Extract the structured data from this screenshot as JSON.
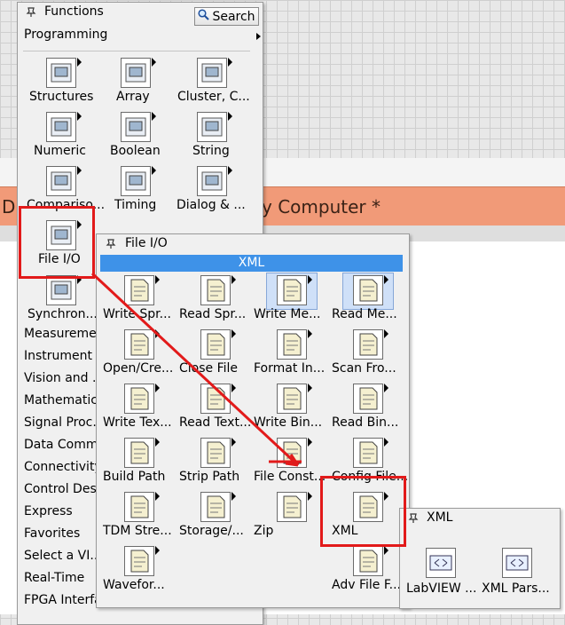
{
  "background": {
    "orange_bar_text_left": "Di",
    "orange_bar_text_right": "y Computer *"
  },
  "functions_palette": {
    "title": "Functions",
    "search_label": "Search",
    "category": "Programming",
    "icons": [
      {
        "label": "Structures",
        "icon": "structures-icon"
      },
      {
        "label": "Array",
        "icon": "array-icon"
      },
      {
        "label": "Cluster, C...",
        "icon": "cluster-icon"
      },
      {
        "label": "Numeric",
        "icon": "numeric-icon"
      },
      {
        "label": "Boolean",
        "icon": "boolean-icon"
      },
      {
        "label": "String",
        "icon": "string-icon"
      },
      {
        "label": "Compariso...",
        "icon": "comparison-icon"
      },
      {
        "label": "Timing",
        "icon": "timing-icon"
      },
      {
        "label": "Dialog & ...",
        "icon": "dialog-icon"
      },
      {
        "label": "File I/O",
        "icon": "file-io-icon"
      },
      {
        "label": "Synchron...",
        "icon": "synchronization-icon"
      }
    ],
    "categories": [
      "Measureme...",
      "Instrument ...",
      "Vision and ...",
      "Mathematic...",
      "Signal Proc...",
      "Data Comm...",
      "Connectivity",
      "Control Des...",
      "Express",
      "Favorites",
      "Select a VI...",
      "Real-Time",
      "FPGA Interface"
    ]
  },
  "file_io_palette": {
    "title": "File I/O",
    "header": "XML",
    "icons": [
      {
        "label": "Write Spr...",
        "icon": "write-spreadsheet-icon"
      },
      {
        "label": "Read Spr...",
        "icon": "read-spreadsheet-icon"
      },
      {
        "label": "Write Me...",
        "icon": "write-measurement-icon"
      },
      {
        "label": "Read Me...",
        "icon": "read-measurement-icon"
      },
      {
        "label": "Open/Cre...",
        "icon": "open-create-file-icon"
      },
      {
        "label": "Close File",
        "icon": "close-file-icon"
      },
      {
        "label": "Format In...",
        "icon": "format-into-file-icon"
      },
      {
        "label": "Scan Fro...",
        "icon": "scan-from-file-icon"
      },
      {
        "label": "Write Tex...",
        "icon": "write-text-icon"
      },
      {
        "label": "Read Text...",
        "icon": "read-text-icon"
      },
      {
        "label": "Write Bin...",
        "icon": "write-binary-icon"
      },
      {
        "label": "Read Bin...",
        "icon": "read-binary-icon"
      },
      {
        "label": "Build Path",
        "icon": "build-path-icon"
      },
      {
        "label": "Strip Path",
        "icon": "strip-path-icon"
      },
      {
        "label": "File Const...",
        "icon": "file-constants-icon"
      },
      {
        "label": "Config File...",
        "icon": "config-file-icon"
      },
      {
        "label": "TDM Stre...",
        "icon": "tdm-streaming-icon"
      },
      {
        "label": "Storage/...",
        "icon": "storage-icon"
      },
      {
        "label": "Zip",
        "icon": "zip-icon"
      },
      {
        "label": "XML",
        "icon": "xml-icon"
      },
      {
        "label": "Wavefor...",
        "icon": "waveform-icon"
      },
      {
        "label": "Adv File F...",
        "icon": "advanced-file-icon"
      }
    ]
  },
  "xml_palette": {
    "title": "XML",
    "icons": [
      {
        "label": "LabVIEW ...",
        "icon": "labview-schema-icon"
      },
      {
        "label": "XML Pars...",
        "icon": "xml-parser-icon"
      }
    ]
  },
  "colors": {
    "highlight_red": "#e21a1a",
    "xml_header_blue": "#3e92e8",
    "orange_bar": "#f19a78"
  }
}
